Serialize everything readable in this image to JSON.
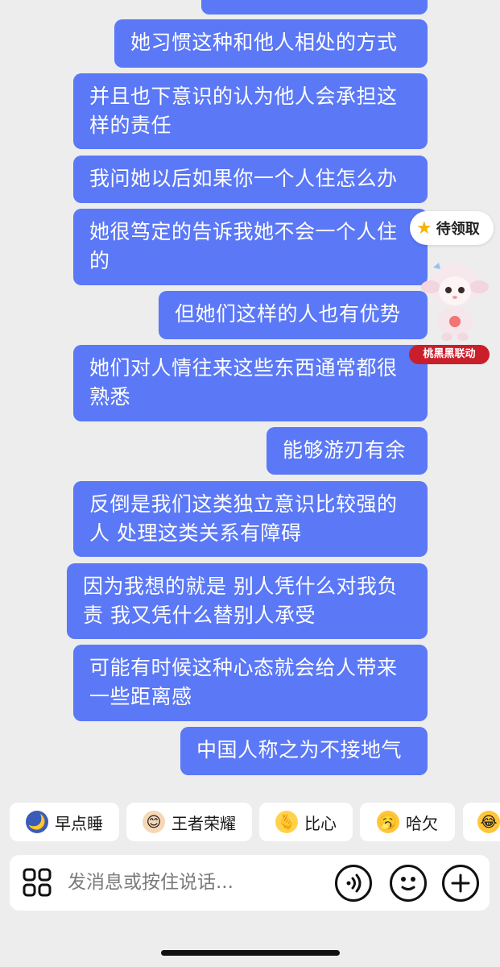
{
  "messages": [
    {
      "text": "她习惯这种和他人相处的方式"
    },
    {
      "text": "并且也下意识的认为他人会承担这样的责任"
    },
    {
      "text": "我问她以后如果你一个人住怎么办"
    },
    {
      "text": "她很笃定的告诉我她不会一个人住的"
    },
    {
      "text": "但她们这样的人也有优势"
    },
    {
      "text": "她们对人情往来这些东西通常都很熟悉"
    },
    {
      "text": "能够游刃有余"
    },
    {
      "text": "反倒是我们这类独立意识比较强的人 处理这类关系有障碍"
    },
    {
      "text": "因为我想的就是 别人凭什么对我负责 我又凭什么替别人承受"
    },
    {
      "text": "可能有时候这种心态就会给人带来一些距离感"
    },
    {
      "text": "中国人称之为不接地气"
    }
  ],
  "float_widget": {
    "pending_label": "待领取",
    "pending_icon": "star-icon",
    "mascot_icon": "lamb-mascot-icon",
    "collab_label": "桃黑黑联动"
  },
  "quick_replies": [
    {
      "label": "早点睡",
      "icon": "sleepy-moon-emoji-icon"
    },
    {
      "label": "王者荣耀",
      "icon": "game-character-emoji-icon"
    },
    {
      "label": "比心",
      "icon": "finger-heart-emoji-icon"
    },
    {
      "label": "哈欠",
      "icon": "yawn-emoji-icon"
    },
    {
      "label": "",
      "icon": "laughing-emoji-icon"
    }
  ],
  "input_bar": {
    "placeholder": "发消息或按住说话...",
    "apps_icon": "apps-grid-icon",
    "voice_icon": "voice-icon",
    "emoji_icon": "emoji-icon",
    "plus_icon": "plus-icon"
  },
  "colors": {
    "bubble": "#5b78f6",
    "background": "#ededed",
    "badge": "#c91f2b"
  }
}
